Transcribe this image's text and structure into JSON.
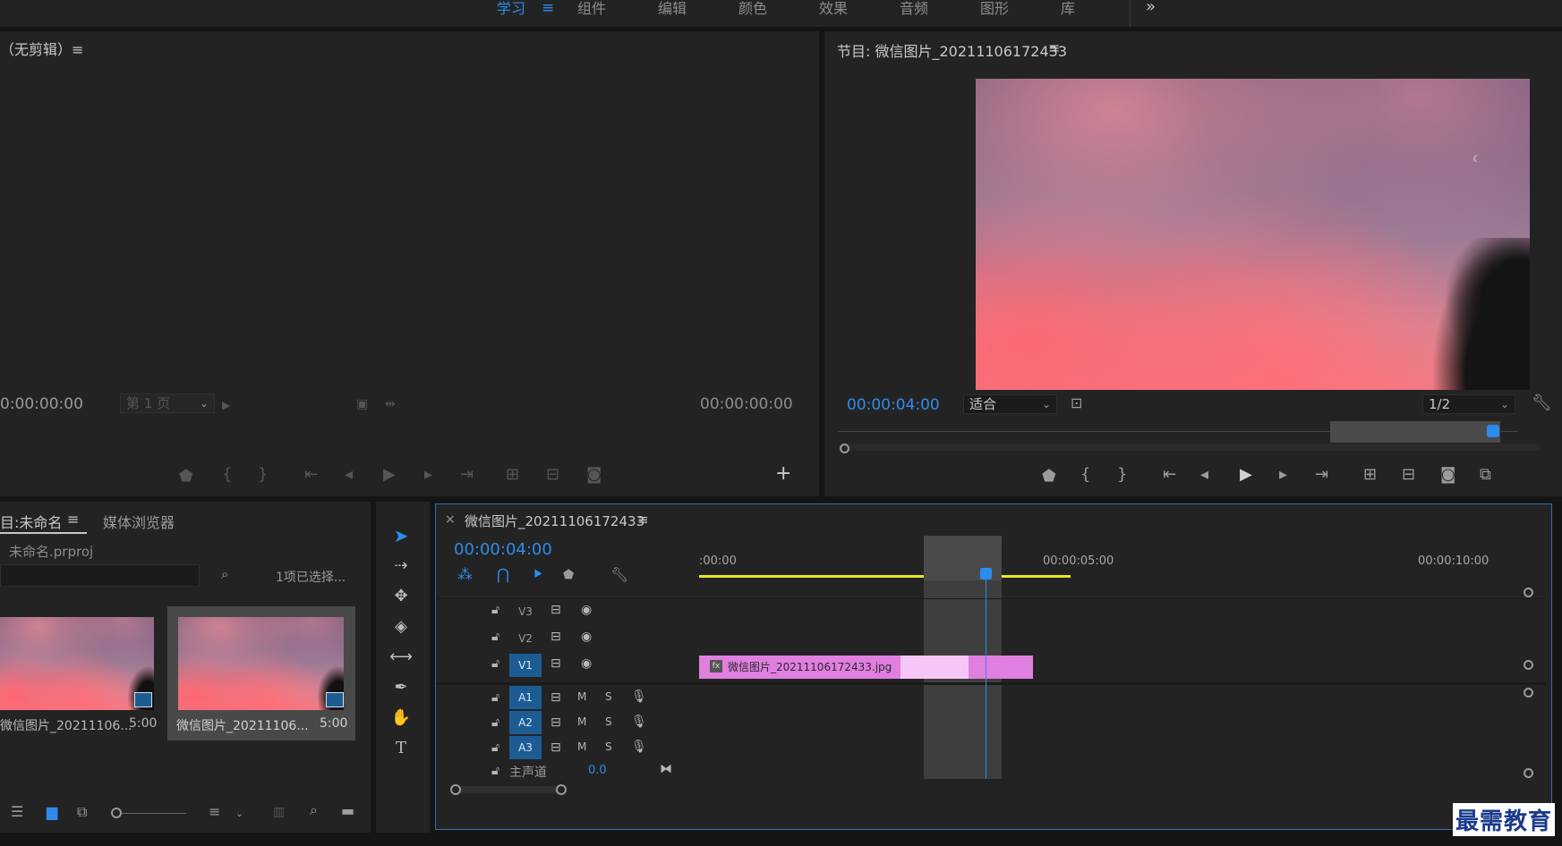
{
  "workspaces": {
    "items": [
      "学习",
      "组件",
      "编辑",
      "颜色",
      "效果",
      "音频",
      "图形",
      "库"
    ],
    "active_index": 0,
    "overflow": "»"
  },
  "source_monitor": {
    "title": "（无剪辑）≡",
    "timecode_left": "0:00:00:00",
    "page_select": "第 1 页",
    "timecode_right": "00:00:00:00"
  },
  "program_monitor": {
    "title": "节目: 微信图片_20211106172433",
    "menu": "≡",
    "timecode": "00:00:04:00",
    "fit_select": "适合",
    "resolution_select": "1/2"
  },
  "project_panel": {
    "tab_project": "目:未命名",
    "tab_menu": "≡",
    "tab_media_browser": "媒体浏览器",
    "project_file": "未命名.prproj",
    "selection_status": "1项已选择...",
    "items": [
      {
        "name": "微信图片_20211106...",
        "duration": "5:00"
      },
      {
        "name": "微信图片_20211106...",
        "duration": "5:00"
      }
    ]
  },
  "timeline": {
    "close": "×",
    "title": "微信图片_20211106172433",
    "menu": "≡",
    "timecode": "00:00:04:00",
    "ruler_labels": [
      ":00:00",
      "00:00:05:00",
      "00:00:10:00"
    ],
    "video_tracks": [
      "V3",
      "V2",
      "V1"
    ],
    "audio_tracks": [
      "A1",
      "A2",
      "A3"
    ],
    "audio_buttons": {
      "mute": "M",
      "solo": "S"
    },
    "master_label": "主声道",
    "master_value": "0.0",
    "clip_name": "微信图片_20211106172433.jpg",
    "clip_badge": "fx",
    "clip_color": "#e07fe0"
  },
  "watermark": "最需教育",
  "colors": {
    "accent_blue": "#2d8ceb",
    "panel_bg": "#232323",
    "gap_bg": "#151515",
    "track_active": "#1c5c93",
    "work_area": "#e8e81a"
  }
}
